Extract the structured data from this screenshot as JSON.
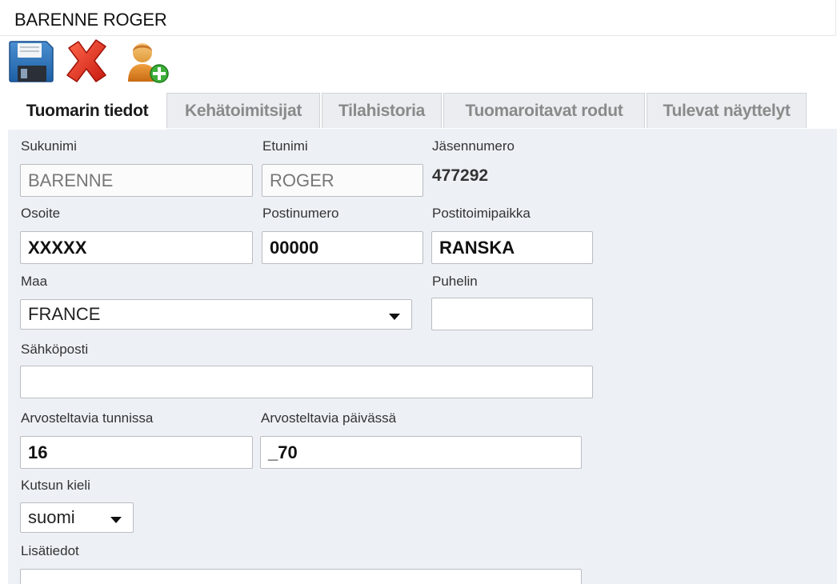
{
  "window": {
    "title": "BARENNE ROGER"
  },
  "toolbar": {
    "save_icon": "floppy-disk-icon",
    "delete_icon": "red-x-icon",
    "add_user_icon": "add-user-icon"
  },
  "tabs": [
    {
      "label": "Tuomarin tiedot",
      "active": true
    },
    {
      "label": "Kehätoimitsijat",
      "active": false
    },
    {
      "label": "Tilahistoria",
      "active": false
    },
    {
      "label": "Tuomaroitavat rodut",
      "active": false
    },
    {
      "label": "Tulevat näyttelyt",
      "active": false
    }
  ],
  "form": {
    "sukunimi": {
      "label": "Sukunimi",
      "value": "BARENNE"
    },
    "etunimi": {
      "label": "Etunimi",
      "value": "ROGER"
    },
    "jasennumero": {
      "label": "Jäsennumero",
      "value": "477292"
    },
    "osoite": {
      "label": "Osoite",
      "value": "XXXXX"
    },
    "postinumero": {
      "label": "Postinumero",
      "value": "00000"
    },
    "postitoimipaikka": {
      "label": "Postitoimipaikka",
      "value": "RANSKA"
    },
    "maa": {
      "label": "Maa",
      "value": "FRANCE"
    },
    "puhelin": {
      "label": "Puhelin",
      "value": ""
    },
    "sahkoposti": {
      "label": "Sähköposti",
      "value": ""
    },
    "arvosteltavia_tunnissa": {
      "label": "Arvosteltavia tunnissa",
      "value": "16"
    },
    "arvosteltavia_paivassa": {
      "label": "Arvosteltavia päivässä",
      "value": "_70"
    },
    "kutsun_kieli": {
      "label": "Kutsun kieli",
      "value": "suomi"
    },
    "lisatiedot": {
      "label": "Lisätiedot",
      "value": ""
    }
  }
}
